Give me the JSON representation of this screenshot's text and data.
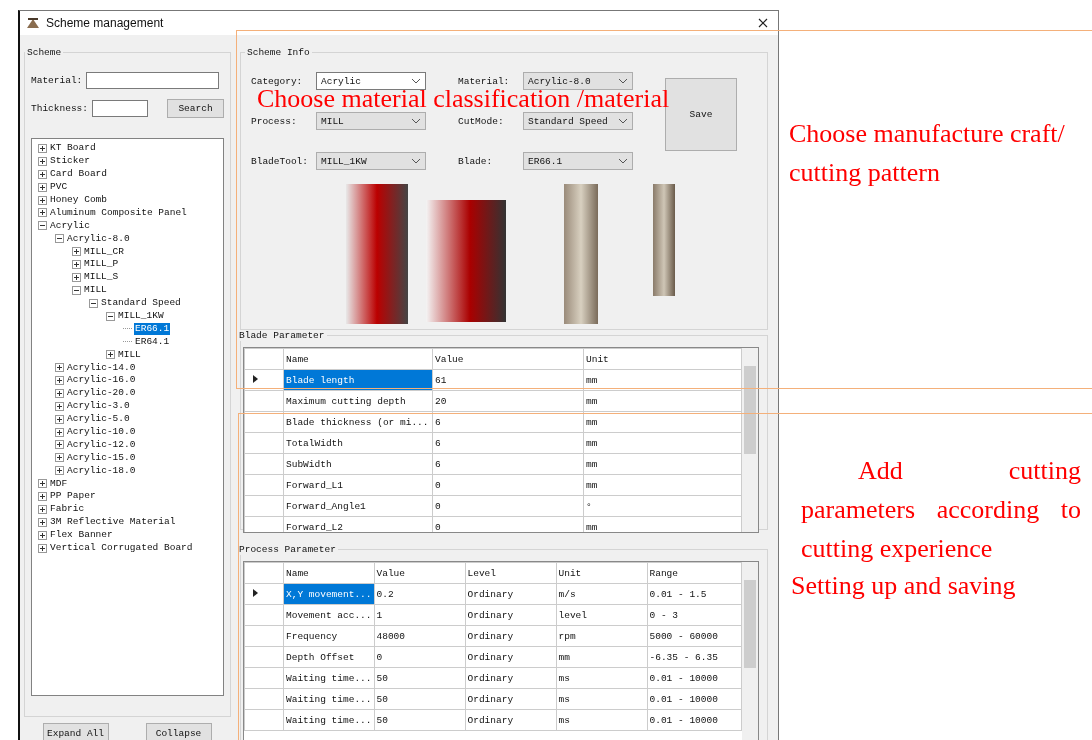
{
  "window": {
    "title": "Scheme management"
  },
  "scheme": {
    "title": "Scheme",
    "material_label": "Material:",
    "thickness_label": "Thickness:",
    "search_button": "Search",
    "tree": [
      {
        "label": "KT Board",
        "expanded": false,
        "selected": false
      },
      {
        "label": "Sticker",
        "expanded": false,
        "selected": false
      },
      {
        "label": "Card Board",
        "expanded": false,
        "selected": false
      },
      {
        "label": "PVC",
        "expanded": false,
        "selected": false
      },
      {
        "label": "Honey Comb",
        "expanded": false,
        "selected": false
      },
      {
        "label": "Aluminum Composite Panel",
        "expanded": false,
        "selected": false
      },
      {
        "label": "Acrylic",
        "expanded": true,
        "selected": false,
        "children": [
          {
            "label": "Acrylic-8.0",
            "expanded": true,
            "selected": false,
            "children": [
              {
                "label": "MILL_CR",
                "expanded": false,
                "selected": false
              },
              {
                "label": "MILL_P",
                "expanded": false,
                "selected": false
              },
              {
                "label": "MILL_S",
                "expanded": false,
                "selected": false
              },
              {
                "label": "MILL",
                "expanded": true,
                "selected": false,
                "children": [
                  {
                    "label": "Standard Speed",
                    "expanded": true,
                    "selected": false,
                    "children": [
                      {
                        "label": "MILL_1KW",
                        "expanded": true,
                        "selected": false,
                        "children": [
                          {
                            "label": "ER66.1",
                            "selected": true
                          },
                          {
                            "label": "ER64.1",
                            "selected": false
                          }
                        ]
                      },
                      {
                        "label": "MILL",
                        "expanded": false,
                        "selected": false
                      }
                    ]
                  }
                ]
              }
            ]
          },
          {
            "label": "Acrylic-14.0",
            "expanded": false,
            "selected": false
          },
          {
            "label": "Acrylic-16.0",
            "expanded": false,
            "selected": false
          },
          {
            "label": "Acrylic-20.0",
            "expanded": false,
            "selected": false
          },
          {
            "label": "Acrylic-3.0",
            "expanded": false,
            "selected": false
          },
          {
            "label": "Acrylic-5.0",
            "expanded": false,
            "selected": false
          },
          {
            "label": "Acrylic-10.0",
            "expanded": false,
            "selected": false
          },
          {
            "label": "Acrylic-12.0",
            "expanded": false,
            "selected": false
          },
          {
            "label": "Acrylic-15.0",
            "expanded": false,
            "selected": false
          },
          {
            "label": "Acrylic-18.0",
            "expanded": false,
            "selected": false
          }
        ]
      },
      {
        "label": "MDF",
        "expanded": false,
        "selected": false
      },
      {
        "label": "PP Paper",
        "expanded": false,
        "selected": false
      },
      {
        "label": "Fabric",
        "expanded": false,
        "selected": false
      },
      {
        "label": "3M Reflective Material",
        "expanded": false,
        "selected": false
      },
      {
        "label": "Flex Banner",
        "expanded": false,
        "selected": false
      },
      {
        "label": "Vertical Corrugated Board",
        "expanded": false,
        "selected": false
      }
    ],
    "expand_button": "Expand All",
    "collapse_button": "Collapse"
  },
  "scheme_info": {
    "title": "Scheme Info",
    "fields": [
      {
        "label": "Category:",
        "value": "Acrylic",
        "kind": "editable"
      },
      {
        "label": "Material:",
        "value": "Acrylic-8.0",
        "kind": "dropdown"
      },
      {
        "label": "Process:",
        "value": "MILL",
        "kind": "dropdown"
      },
      {
        "label": "CutMode:",
        "value": "Standard Speed",
        "kind": "dropdown"
      },
      {
        "label": "BladeTool:",
        "value": "MILL_1KW",
        "kind": "dropdown"
      },
      {
        "label": "Blade:",
        "value": "ER66.1",
        "kind": "dropdown"
      }
    ],
    "save_button": "Save"
  },
  "blade_parameter": {
    "title": "Blade Parameter",
    "columns": [
      "Name",
      "Value",
      "Unit"
    ],
    "rows": [
      {
        "cells": [
          "Blade length",
          "61",
          "mm"
        ],
        "selected": true
      },
      {
        "cells": [
          "Maximum cutting depth",
          "20",
          "mm"
        ],
        "selected": false
      },
      {
        "cells": [
          "Blade thickness (or mi...",
          "6",
          "mm"
        ],
        "selected": false
      },
      {
        "cells": [
          "TotalWidth",
          "6",
          "mm"
        ],
        "selected": false
      },
      {
        "cells": [
          "SubWidth",
          "6",
          "mm"
        ],
        "selected": false
      },
      {
        "cells": [
          "Forward_L1",
          "0",
          "mm"
        ],
        "selected": false
      },
      {
        "cells": [
          "Forward_Angle1",
          "0",
          "°"
        ],
        "selected": false
      },
      {
        "cells": [
          "Forward_L2",
          "0",
          "mm"
        ],
        "selected": false
      }
    ]
  },
  "process_parameter": {
    "title": "Process Parameter",
    "columns": [
      "Name",
      "Value",
      "Level",
      "Unit",
      "Range"
    ],
    "rows": [
      {
        "cells": [
          "X,Y movement...",
          "0.2",
          "Ordinary",
          "m/s",
          "0.01 - 1.5"
        ],
        "selected": true
      },
      {
        "cells": [
          "Movement acc...",
          "1",
          "Ordinary",
          "level",
          "0 - 3"
        ],
        "selected": false
      },
      {
        "cells": [
          "Frequency",
          "48000",
          "Ordinary",
          "rpm",
          "5000 - 60000"
        ],
        "selected": false
      },
      {
        "cells": [
          "Depth Offset",
          "0",
          "Ordinary",
          "mm",
          "-6.35 - 6.35"
        ],
        "selected": false
      },
      {
        "cells": [
          "Waiting time...",
          "50",
          "Ordinary",
          "ms",
          "0.01 - 10000"
        ],
        "selected": false
      },
      {
        "cells": [
          "Waiting time...",
          "50",
          "Ordinary",
          "ms",
          "0.01 - 10000"
        ],
        "selected": false
      },
      {
        "cells": [
          "Waiting time...",
          "50",
          "Ordinary",
          "ms",
          "0.01 - 10000"
        ],
        "selected": false
      }
    ]
  },
  "annotations": {
    "overlay_caption": "Choose material classification /material",
    "craft_note": "Choose manufacture craft/ cutting pattern",
    "parameter_note": "Add cutting parameters according to cutting experience",
    "save_note": "Setting up and saving"
  }
}
